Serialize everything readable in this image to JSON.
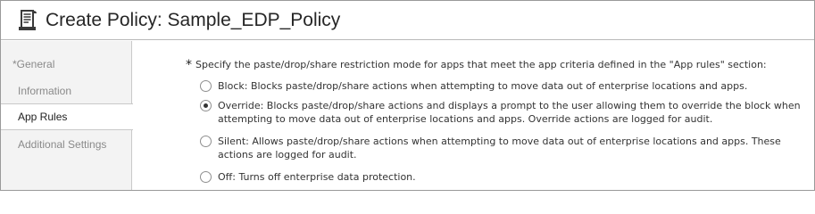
{
  "header": {
    "title": "Create Policy: Sample_EDP_Policy",
    "icon": "policy-scroll-icon"
  },
  "sidebar": {
    "items": [
      {
        "label": "*General",
        "active": false
      },
      {
        "label": "Information",
        "active": false
      },
      {
        "label": "App Rules",
        "active": true
      },
      {
        "label": "Additional Settings",
        "active": false
      }
    ]
  },
  "main": {
    "required_marker": "*",
    "prompt": "Specify the paste/drop/share restriction mode for apps that meet the app criteria defined in the \"App rules\" section:",
    "options": [
      {
        "lines": [
          "Block: Blocks paste/drop/share actions when attempting to move data out of enterprise locations and apps."
        ],
        "selected": false
      },
      {
        "lines": [
          "Override: Blocks paste/drop/share actions and displays a prompt to the user allowing them to override the block when",
          "attempting to move data out of enterprise locations and apps. Override actions are logged for audit."
        ],
        "selected": true
      },
      {
        "lines": [
          "Silent: Allows paste/drop/share actions when attempting to move data out of enterprise locations and apps. These",
          "actions are logged for audit."
        ],
        "selected": false
      },
      {
        "lines": [
          "Off: Turns off enterprise data protection."
        ],
        "selected": false
      }
    ]
  }
}
